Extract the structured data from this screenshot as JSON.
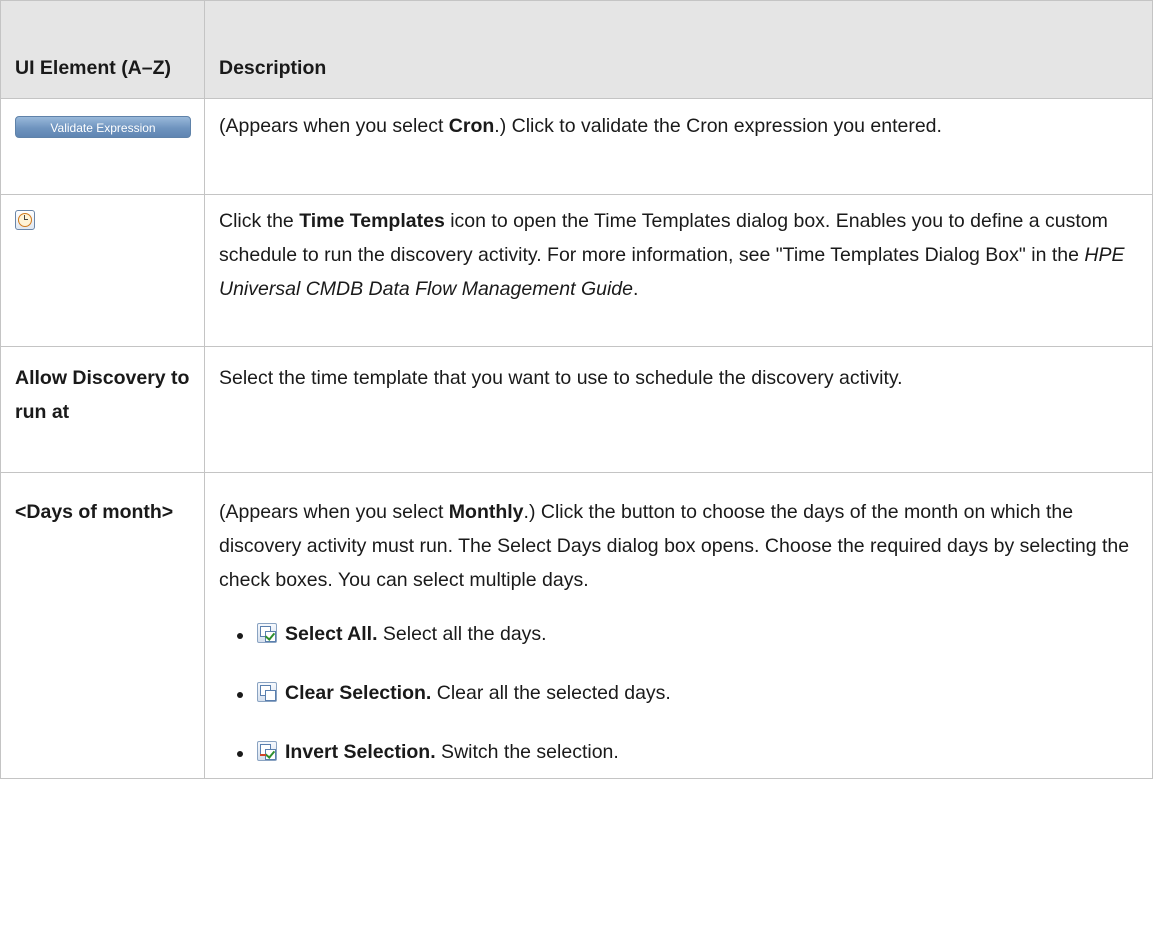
{
  "header": {
    "col1": "UI Element (A–Z)",
    "col2": "Description"
  },
  "rows": {
    "validate": {
      "button_label": "Validate Expression",
      "desc_pre": "(Appears when you select ",
      "desc_bold": "Cron",
      "desc_post": ".) Click to validate the Cron expression you entered."
    },
    "time_templates": {
      "desc_pre": "Click the ",
      "desc_bold": "Time Templates",
      "desc_mid": " icon to open the Time Templates dialog box. Enables you to define a custom schedule to run the discovery activity. For more information, see \"Time Templates Dialog Box\" in the ",
      "desc_italic": "HPE Universal CMDB Data Flow Management Guide",
      "desc_post": "."
    },
    "allow": {
      "name": "Allow Discovery to run at",
      "desc": "Select the time template that you want to use to schedule the discovery activity."
    },
    "days": {
      "name": "<Days of month>",
      "desc_pre": "(Appears when you select ",
      "desc_bold": "Monthly",
      "desc_post": ".) Click the button to choose the days of the month on which the discovery activity must run. The Select Days dialog box opens. Choose the required days by selecting the check boxes. You can select multiple days.",
      "options": [
        {
          "icon": "select-all-icon",
          "label": "Select All.",
          "text": " Select all the days."
        },
        {
          "icon": "clear-selection-icon",
          "label": "Clear Selection.",
          "text": " Clear all the selected days."
        },
        {
          "icon": "invert-selection-icon",
          "label": "Invert Selection.",
          "text": " Switch the selection."
        }
      ]
    }
  }
}
